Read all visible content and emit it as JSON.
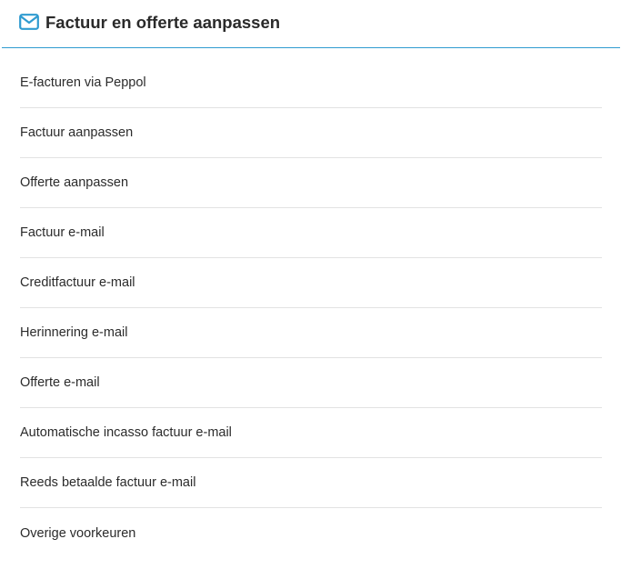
{
  "header": {
    "icon": "envelope-icon",
    "title": "Factuur en offerte aanpassen",
    "accent_color": "#2f9bd0"
  },
  "menu": {
    "items": [
      {
        "label": "E-facturen via Peppol"
      },
      {
        "label": "Factuur aanpassen"
      },
      {
        "label": "Offerte aanpassen"
      },
      {
        "label": "Factuur e-mail"
      },
      {
        "label": "Creditfactuur e-mail"
      },
      {
        "label": "Herinnering e-mail"
      },
      {
        "label": "Offerte e-mail"
      },
      {
        "label": "Automatische incasso factuur e-mail"
      },
      {
        "label": "Reeds betaalde factuur e-mail"
      },
      {
        "label": "Overige voorkeuren"
      }
    ]
  }
}
